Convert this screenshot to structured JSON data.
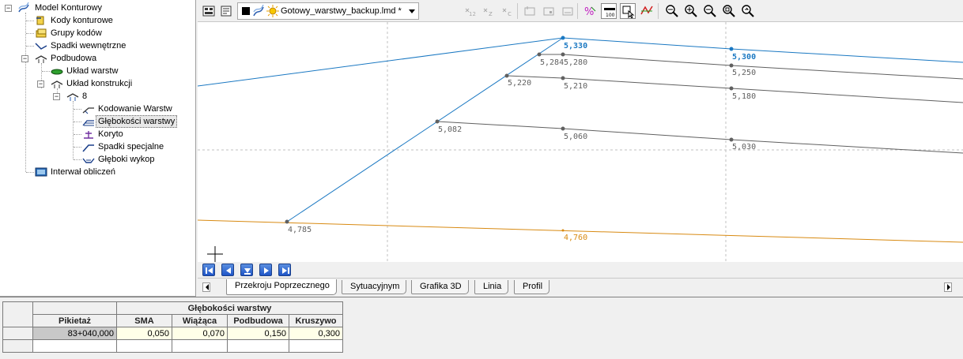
{
  "tree": {
    "items": [
      {
        "label": "Model Konturowy",
        "icon": "contour-model-icon",
        "level": 0,
        "toggle": "−"
      },
      {
        "label": "Kody konturowe",
        "icon": "contour-codes-icon",
        "level": 1
      },
      {
        "label": "Grupy kodów",
        "icon": "code-groups-icon",
        "level": 1
      },
      {
        "label": "Spadki wewnętrzne",
        "icon": "internal-slopes-icon",
        "level": 1
      },
      {
        "label": "Podbudowa",
        "icon": "base-layer-icon",
        "level": 1,
        "toggle": "−"
      },
      {
        "label": "Układ warstw",
        "icon": "layer-layout-icon",
        "level": 2
      },
      {
        "label": "Układ konstrukcji",
        "icon": "construction-layout-icon",
        "level": 2,
        "toggle": "−"
      },
      {
        "label": "8",
        "icon": "construction-8-icon",
        "level": 3,
        "toggle": "−"
      },
      {
        "label": "Kodowanie Warstw",
        "icon": "layer-coding-icon",
        "level": 4
      },
      {
        "label": "Głębokości warstwy",
        "icon": "layer-depths-icon",
        "level": 4,
        "selected": true
      },
      {
        "label": "Koryto",
        "icon": "trough-icon",
        "level": 4
      },
      {
        "label": "Spadki specjalne",
        "icon": "special-slopes-icon",
        "level": 4
      },
      {
        "label": "Głęboki wykop",
        "icon": "deep-excavation-icon",
        "level": 4
      },
      {
        "label": "Interwał obliczeń",
        "icon": "calc-interval-icon",
        "level": 1
      }
    ]
  },
  "toolbar": {
    "file_name": "Gotowy_warstwy_backup.lmd *"
  },
  "drawing": {
    "colors": {
      "top": "#1a78c2",
      "layer": "#606060",
      "bottom": "#d88a12",
      "grid": "#c0c0c0"
    },
    "labels": {
      "p1": "5,330",
      "p2": "5,300",
      "p3": "5,284",
      "p4": "5,280",
      "p5": "5,250",
      "p6": "5,220",
      "p7": "5,210",
      "p8": "5,180",
      "p9": "5,082",
      "p10": "5,060",
      "p11": "5,030",
      "p12": "4,785",
      "p13": "4,760"
    }
  },
  "tabs": [
    {
      "label": "Przekroju Poprzecznego",
      "active": true
    },
    {
      "label": "Sytuacyjnym"
    },
    {
      "label": "Grafika 3D"
    },
    {
      "label": "Linia"
    },
    {
      "label": "Profil"
    }
  ],
  "grid": {
    "group_header": "Głębokości warstwy",
    "columns": [
      "Pikietaż",
      "SMA",
      "Wiążąca",
      "Podbudowa",
      "Kruszywo"
    ],
    "rows": [
      [
        "83+040,000",
        "0,050",
        "0,070",
        "0,150",
        "0,300"
      ]
    ]
  }
}
